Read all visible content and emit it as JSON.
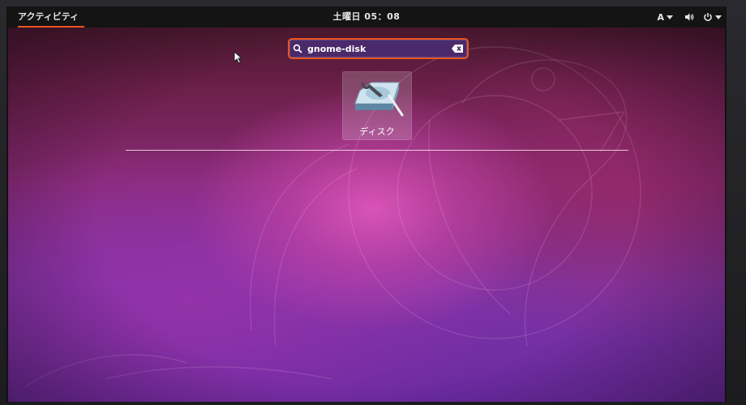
{
  "topbar": {
    "activities_label": "アクティビティ",
    "clock": "土曜日 05：08",
    "input_indicator": "A",
    "icons": [
      "volume-icon",
      "power-icon"
    ]
  },
  "search": {
    "value": "gnome-disk",
    "icons": [
      "search-icon",
      "clear-icon"
    ]
  },
  "results": [
    {
      "label": "ディスク",
      "icon": "disk-utility-icon"
    }
  ],
  "colors": {
    "accent": "#e95420",
    "topbar": "#141414"
  }
}
